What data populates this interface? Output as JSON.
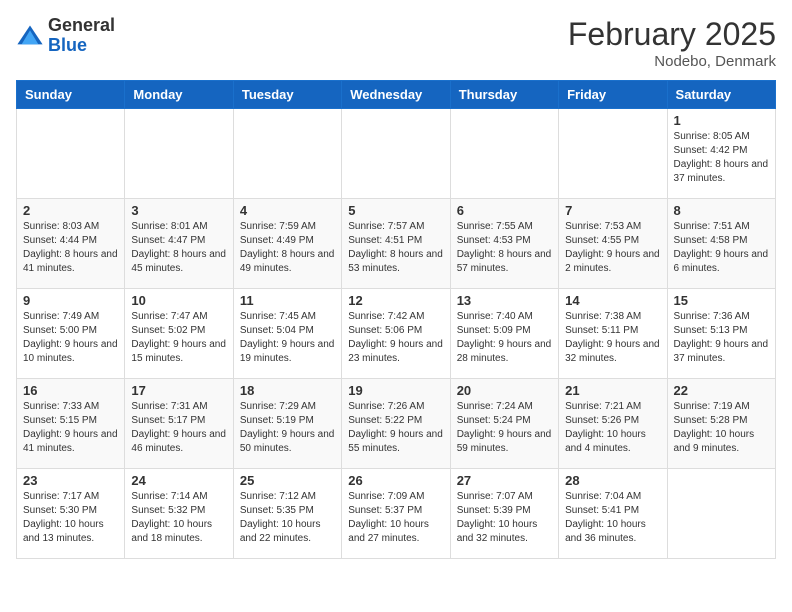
{
  "header": {
    "logo": {
      "general": "General",
      "blue": "Blue"
    },
    "title": "February 2025",
    "subtitle": "Nodebo, Denmark"
  },
  "calendar": {
    "days_of_week": [
      "Sunday",
      "Monday",
      "Tuesday",
      "Wednesday",
      "Thursday",
      "Friday",
      "Saturday"
    ],
    "weeks": [
      [
        {
          "day": "",
          "info": ""
        },
        {
          "day": "",
          "info": ""
        },
        {
          "day": "",
          "info": ""
        },
        {
          "day": "",
          "info": ""
        },
        {
          "day": "",
          "info": ""
        },
        {
          "day": "",
          "info": ""
        },
        {
          "day": "1",
          "info": "Sunrise: 8:05 AM\nSunset: 4:42 PM\nDaylight: 8 hours and 37 minutes."
        }
      ],
      [
        {
          "day": "2",
          "info": "Sunrise: 8:03 AM\nSunset: 4:44 PM\nDaylight: 8 hours and 41 minutes."
        },
        {
          "day": "3",
          "info": "Sunrise: 8:01 AM\nSunset: 4:47 PM\nDaylight: 8 hours and 45 minutes."
        },
        {
          "day": "4",
          "info": "Sunrise: 7:59 AM\nSunset: 4:49 PM\nDaylight: 8 hours and 49 minutes."
        },
        {
          "day": "5",
          "info": "Sunrise: 7:57 AM\nSunset: 4:51 PM\nDaylight: 8 hours and 53 minutes."
        },
        {
          "day": "6",
          "info": "Sunrise: 7:55 AM\nSunset: 4:53 PM\nDaylight: 8 hours and 57 minutes."
        },
        {
          "day": "7",
          "info": "Sunrise: 7:53 AM\nSunset: 4:55 PM\nDaylight: 9 hours and 2 minutes."
        },
        {
          "day": "8",
          "info": "Sunrise: 7:51 AM\nSunset: 4:58 PM\nDaylight: 9 hours and 6 minutes."
        }
      ],
      [
        {
          "day": "9",
          "info": "Sunrise: 7:49 AM\nSunset: 5:00 PM\nDaylight: 9 hours and 10 minutes."
        },
        {
          "day": "10",
          "info": "Sunrise: 7:47 AM\nSunset: 5:02 PM\nDaylight: 9 hours and 15 minutes."
        },
        {
          "day": "11",
          "info": "Sunrise: 7:45 AM\nSunset: 5:04 PM\nDaylight: 9 hours and 19 minutes."
        },
        {
          "day": "12",
          "info": "Sunrise: 7:42 AM\nSunset: 5:06 PM\nDaylight: 9 hours and 23 minutes."
        },
        {
          "day": "13",
          "info": "Sunrise: 7:40 AM\nSunset: 5:09 PM\nDaylight: 9 hours and 28 minutes."
        },
        {
          "day": "14",
          "info": "Sunrise: 7:38 AM\nSunset: 5:11 PM\nDaylight: 9 hours and 32 minutes."
        },
        {
          "day": "15",
          "info": "Sunrise: 7:36 AM\nSunset: 5:13 PM\nDaylight: 9 hours and 37 minutes."
        }
      ],
      [
        {
          "day": "16",
          "info": "Sunrise: 7:33 AM\nSunset: 5:15 PM\nDaylight: 9 hours and 41 minutes."
        },
        {
          "day": "17",
          "info": "Sunrise: 7:31 AM\nSunset: 5:17 PM\nDaylight: 9 hours and 46 minutes."
        },
        {
          "day": "18",
          "info": "Sunrise: 7:29 AM\nSunset: 5:19 PM\nDaylight: 9 hours and 50 minutes."
        },
        {
          "day": "19",
          "info": "Sunrise: 7:26 AM\nSunset: 5:22 PM\nDaylight: 9 hours and 55 minutes."
        },
        {
          "day": "20",
          "info": "Sunrise: 7:24 AM\nSunset: 5:24 PM\nDaylight: 9 hours and 59 minutes."
        },
        {
          "day": "21",
          "info": "Sunrise: 7:21 AM\nSunset: 5:26 PM\nDaylight: 10 hours and 4 minutes."
        },
        {
          "day": "22",
          "info": "Sunrise: 7:19 AM\nSunset: 5:28 PM\nDaylight: 10 hours and 9 minutes."
        }
      ],
      [
        {
          "day": "23",
          "info": "Sunrise: 7:17 AM\nSunset: 5:30 PM\nDaylight: 10 hours and 13 minutes."
        },
        {
          "day": "24",
          "info": "Sunrise: 7:14 AM\nSunset: 5:32 PM\nDaylight: 10 hours and 18 minutes."
        },
        {
          "day": "25",
          "info": "Sunrise: 7:12 AM\nSunset: 5:35 PM\nDaylight: 10 hours and 22 minutes."
        },
        {
          "day": "26",
          "info": "Sunrise: 7:09 AM\nSunset: 5:37 PM\nDaylight: 10 hours and 27 minutes."
        },
        {
          "day": "27",
          "info": "Sunrise: 7:07 AM\nSunset: 5:39 PM\nDaylight: 10 hours and 32 minutes."
        },
        {
          "day": "28",
          "info": "Sunrise: 7:04 AM\nSunset: 5:41 PM\nDaylight: 10 hours and 36 minutes."
        },
        {
          "day": "",
          "info": ""
        }
      ]
    ]
  }
}
